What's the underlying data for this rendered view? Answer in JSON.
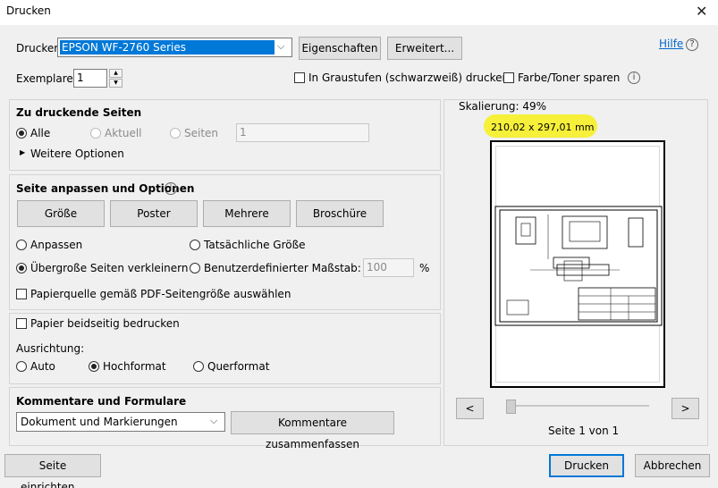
{
  "window": {
    "title": "Drucken",
    "close": "✕"
  },
  "printer": {
    "label": "Drucker:",
    "selected": "EPSON WF-2760 Series",
    "properties_button": "Eigenschaften",
    "advanced_button": "Erweitert...",
    "help_link": "Hilfe",
    "help_icon": "?"
  },
  "copies": {
    "label": "Exemplare:",
    "value": "1"
  },
  "options": {
    "grayscale": "In Graustufen (schwarzweiß) drucken",
    "save_toner": "Farbe/Toner sparen"
  },
  "pages": {
    "title": "Zu druckende Seiten",
    "all": "Alle",
    "current": "Aktuell",
    "pages": "Seiten",
    "pages_value": "1",
    "more_options": "Weitere Optionen"
  },
  "fit": {
    "title": "Seite anpassen und Optionen",
    "buttons": [
      "Größe",
      "Poster",
      "Mehrere",
      "Broschüre"
    ],
    "fit_label": "Anpassen",
    "actual_size": "Tatsächliche Größe",
    "shrink_oversized": "Übergroße Seiten verkleinern",
    "custom_scale": "Benutzerdefinierter Maßstab:",
    "scale_value": "100",
    "percent": "%",
    "paper_source": "Papierquelle gemäß PDF-Seitengröße auswählen"
  },
  "duplex": {
    "label": "Papier beidseitig bedrucken"
  },
  "orientation": {
    "label": "Ausrichtung:",
    "auto": "Auto",
    "portrait": "Hochformat",
    "landscape": "Querformat"
  },
  "comments": {
    "title": "Kommentare und Formulare",
    "selected": "Dokument und Markierungen",
    "summarize_button": "Kommentare zusammenfassen"
  },
  "preview": {
    "scaling": "Skalierung:  49%",
    "size": "210,02 x 297,01 mm",
    "prev": "<",
    "next": ">",
    "page_info": "Seite 1 von 1"
  },
  "footer": {
    "page_setup": "Seite einrichten...",
    "print": "Drucken",
    "cancel": "Abbrechen"
  }
}
